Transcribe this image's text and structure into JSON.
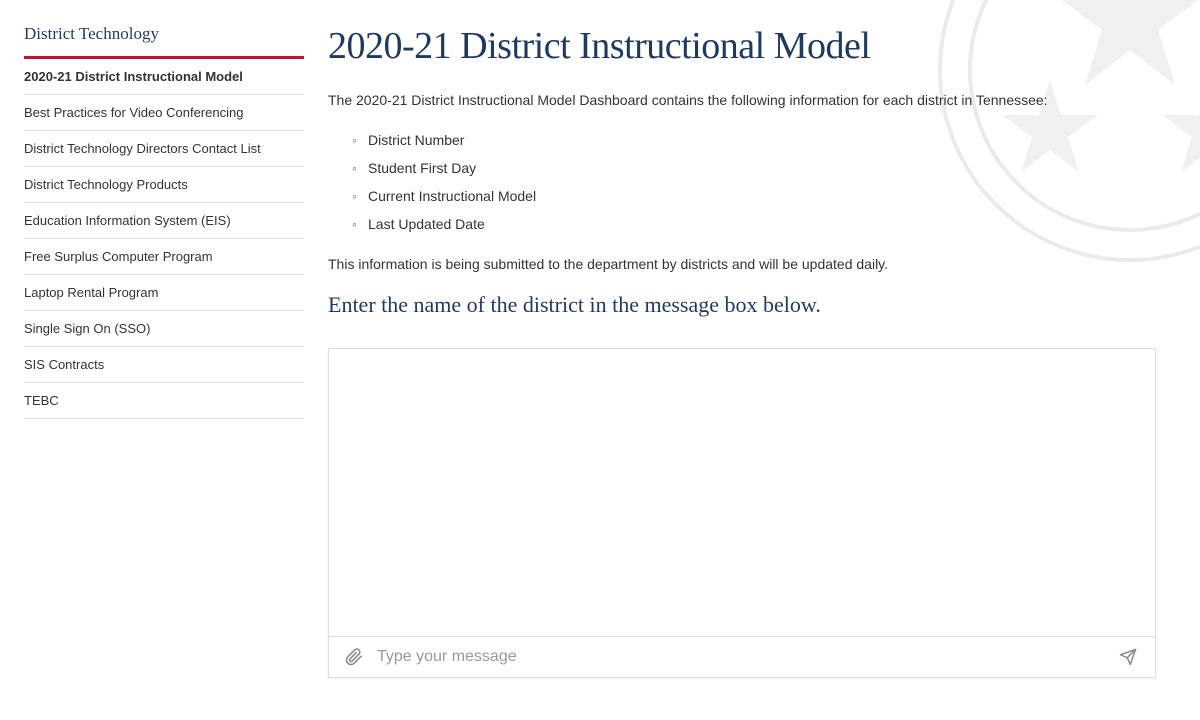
{
  "sidebar": {
    "title": "District Technology",
    "items": [
      {
        "label": "2020-21 District Instructional Model",
        "active": true
      },
      {
        "label": "Best Practices for Video Conferencing",
        "active": false
      },
      {
        "label": "District Technology Directors Contact List",
        "active": false
      },
      {
        "label": "District Technology Products",
        "active": false
      },
      {
        "label": "Education Information System (EIS)",
        "active": false
      },
      {
        "label": "Free Surplus Computer Program",
        "active": false
      },
      {
        "label": "Laptop Rental Program",
        "active": false
      },
      {
        "label": "Single Sign On (SSO)",
        "active": false
      },
      {
        "label": "SIS Contracts",
        "active": false
      },
      {
        "label": "TEBC",
        "active": false
      }
    ]
  },
  "main": {
    "title": "2020-21 District Instructional Model",
    "intro": "The 2020-21 District Instructional Model Dashboard contains the following information for each district in Tennessee:",
    "bullets": [
      "District Number",
      "Student First Day",
      "Current Instructional Model",
      "Last Updated Date"
    ],
    "update_note": "This information is being submitted to the department by districts and will be updated daily.",
    "prompt_heading": "Enter the name of the district in the message box below."
  },
  "chat": {
    "placeholder": "Type your message"
  }
}
